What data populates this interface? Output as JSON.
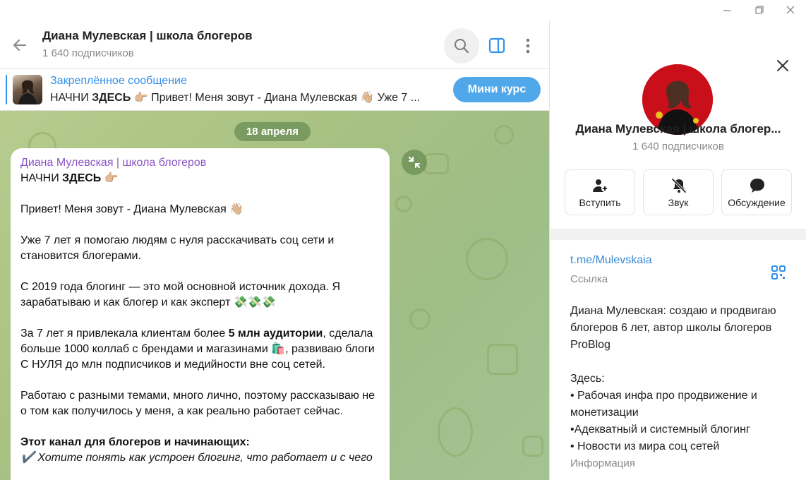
{
  "header": {
    "title": "Диана Мулевская | школа блогеров",
    "subscribers": "1 640 подписчиков"
  },
  "pinned": {
    "label": "Закреплённое сообщение",
    "text_prefix": "НАЧНИ ",
    "text_bold": "ЗДЕСЬ",
    "text_rest": " 👉🏼  Привет! Меня зовут - Диана Мулевская 👋🏼  Уже 7 ...",
    "button": "Мини курс"
  },
  "chat": {
    "date": "18 апреля",
    "message": {
      "author": "Диана Мулевская | школа блогеров",
      "line1_prefix": "НАЧНИ ",
      "line1_bold": "ЗДЕСЬ",
      "line1_emoji": " 👉🏼",
      "p1": "Привет! Меня зовут - Диана Мулевская 👋🏼",
      "p2": "Уже 7 лет я помогаю людям с нуля расскачивать соц сети и становится блогерами.",
      "p3": "С 2019 года блогинг — это мой основной источник дохода. Я зарабатываю и как блогер и как эксперт 💸💸💸",
      "p4_a": "За 7 лет я привлекала клиентам более ",
      "p4_bold": "5 млн аудитории",
      "p4_b": ", сделала больше 1000 коллаб с брендами и магазинами 🛍️, развиваю блоги С НУЛЯ до млн подписчиков и медийности вне соц сетей.",
      "p5": "Работаю с разными темами, много лично, поэтому рассказываю не о том как получилось у меня, а как реально работает сейчас.",
      "p6_bold": "Этот канал для блогеров и начинающих:",
      "p7": "✔️ Хотите понять как устроен блогинг, что работает и с чего"
    }
  },
  "side": {
    "name": "Диана Мулевская | школа блогер...",
    "subscribers": "1 640 подписчиков",
    "actions": [
      {
        "label": "Вступить",
        "icon": "add-user-icon"
      },
      {
        "label": "Звук",
        "icon": "bell-muted-icon"
      },
      {
        "label": "Обсуждение",
        "icon": "chat-bubble-icon"
      }
    ],
    "link": "t.me/Mulevskaia",
    "link_label": "Ссылка",
    "bio": [
      "Диана Мулевская: создаю и продвигаю блогеров 6 лет, автор школы блогеров ProBlog",
      "",
      "Здесь:",
      "• Рабочая инфа про продвижение и монетизации",
      "•Адекватный и системный блогинг",
      "• Новости из мира соц сетей"
    ],
    "info_label": "Информация"
  },
  "colors": {
    "accent": "#3390ec",
    "author": "#8b55c6",
    "button": "#50a8eb",
    "chat_bg": "#a9c283"
  }
}
